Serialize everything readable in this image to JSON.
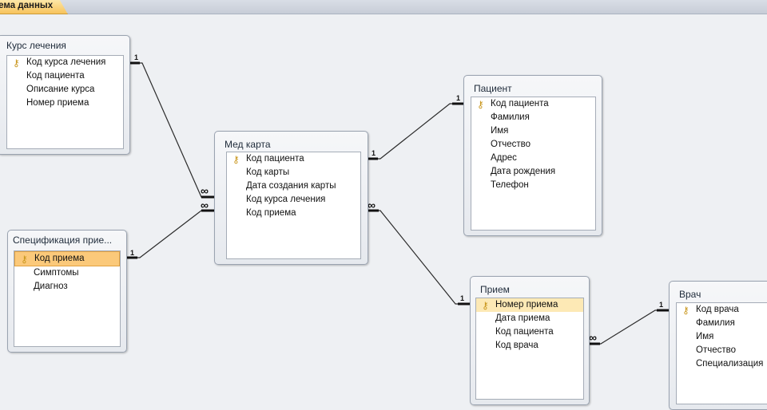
{
  "tab": {
    "label": "хема данных"
  },
  "tables": {
    "kurs": {
      "title": "Курс лечения",
      "fields": [
        "Код курса лечения",
        "Код пациента",
        "Описание курса",
        "Номер приема"
      ]
    },
    "spec": {
      "title": "Спецификация прие...",
      "fields": [
        "Код приема",
        "Симптомы",
        "Диагноз"
      ]
    },
    "medkarta": {
      "title": "Мед карта",
      "fields": [
        "Код пациента",
        "Код карты",
        "Дата создания карты",
        "Код курса лечения",
        "Код приема"
      ]
    },
    "pacient": {
      "title": "Пациент",
      "fields": [
        "Код пациента",
        "Фамилия",
        "Имя",
        "Отчество",
        "Адрес",
        "Дата рождения",
        "Телефон"
      ]
    },
    "priem": {
      "title": "Прием",
      "fields": [
        "Номер приема",
        "Дата приема",
        "Код пациента",
        "Код врача"
      ]
    },
    "vrach": {
      "title": "Врач",
      "fields": [
        "Код врача",
        "Фамилия",
        "Имя",
        "Отчество",
        "Специализация"
      ]
    }
  },
  "relations": {
    "one": "1",
    "many": "∞"
  },
  "icons": {
    "primary_key": "key-icon"
  },
  "colors": {
    "tab": "#f7c35c",
    "selected_field": "#fbc97a",
    "highlight_field": "#fde9b5"
  }
}
